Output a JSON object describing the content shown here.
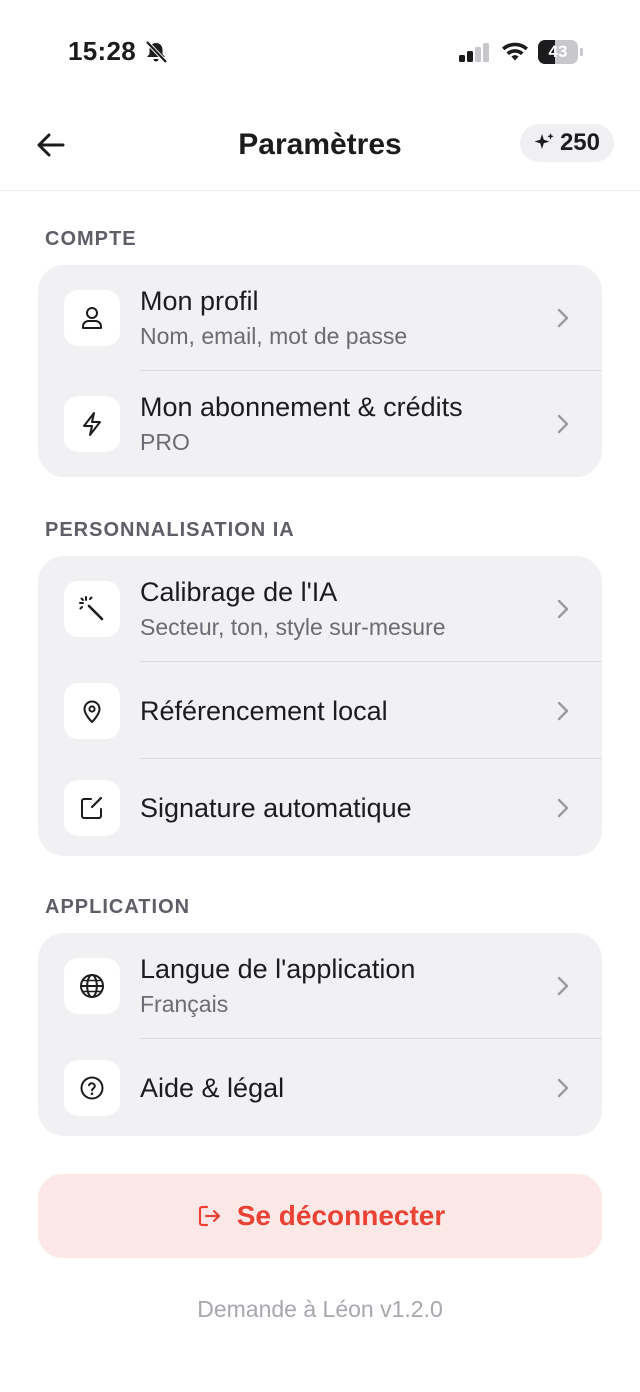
{
  "status_bar": {
    "time": "15:28",
    "battery_level": "43",
    "battery_fraction": 0.43
  },
  "header": {
    "title": "Paramètres",
    "credits": "250"
  },
  "sections": {
    "account": {
      "label": "COMPTE",
      "items": [
        {
          "icon": "user-icon",
          "title": "Mon profil",
          "subtitle": "Nom, email, mot de passe"
        },
        {
          "icon": "lightning-icon",
          "title": "Mon abonnement & crédits",
          "subtitle": "PRO"
        }
      ]
    },
    "ai": {
      "label": "PERSONNALISATION IA",
      "items": [
        {
          "icon": "magic-wand-icon",
          "title": "Calibrage de l'IA",
          "subtitle": "Secteur, ton, style sur-mesure"
        },
        {
          "icon": "map-pin-icon",
          "title": "Référencement local"
        },
        {
          "icon": "edit-square-icon",
          "title": "Signature automatique"
        }
      ]
    },
    "app": {
      "label": "APPLICATION",
      "items": [
        {
          "icon": "globe-icon",
          "title": "Langue de l'application",
          "subtitle": "Français"
        },
        {
          "icon": "help-circle-icon",
          "title": "Aide & légal"
        }
      ]
    }
  },
  "logout": {
    "label": "Se déconnecter",
    "icon": "logout-icon"
  },
  "footer": {
    "version": "Demande à Léon v1.2.0"
  },
  "colors": {
    "accent_red": "#ea4335",
    "logout_bg": "#fde8e8",
    "card_bg": "#f1f1f4"
  }
}
